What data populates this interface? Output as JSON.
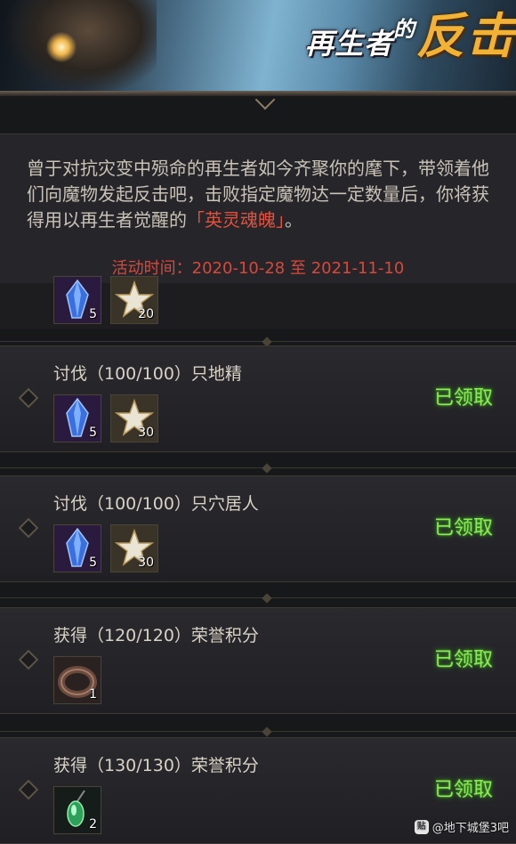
{
  "banner": {
    "title_part1": "再生者",
    "title_part2": "的",
    "title_part3": "反击"
  },
  "description": {
    "text_before": "曾于对抗灾变中殒命的再生者如今齐聚你的麾下，带领着他们向魔物发起反击吧，击败指定魔物达一定数量后，你将获得用以再生者觉醒的",
    "highlight": "「英灵魂魄」",
    "text_after": "。",
    "time": "活动时间：2020-10-28 至 2021-11-10"
  },
  "partial_row": {
    "items": [
      {
        "icon": "crystal-icon",
        "count": "5"
      },
      {
        "icon": "star-badge-icon",
        "count": "20"
      }
    ]
  },
  "quests": [
    {
      "title": "讨伐（100/100）只地精",
      "status": "已领取",
      "items": [
        {
          "icon": "crystal-icon",
          "count": "5"
        },
        {
          "icon": "star-badge-icon",
          "count": "30"
        }
      ]
    },
    {
      "title": "讨伐（100/100）只穴居人",
      "status": "已领取",
      "items": [
        {
          "icon": "crystal-icon",
          "count": "5"
        },
        {
          "icon": "star-badge-icon",
          "count": "30"
        }
      ]
    },
    {
      "title": "获得（120/120）荣誉积分",
      "status": "已领取",
      "items": [
        {
          "icon": "bracelet-icon",
          "count": "1"
        }
      ]
    },
    {
      "title": "获得（130/130）荣誉积分",
      "status": "已领取",
      "items": [
        {
          "icon": "green-pendant-icon",
          "count": "2"
        }
      ]
    }
  ],
  "watermark": "@地下城堡3吧",
  "colors": {
    "status_green": "#8ee85a",
    "highlight_red": "#e5503c",
    "banner_gold": "#f2b233"
  }
}
